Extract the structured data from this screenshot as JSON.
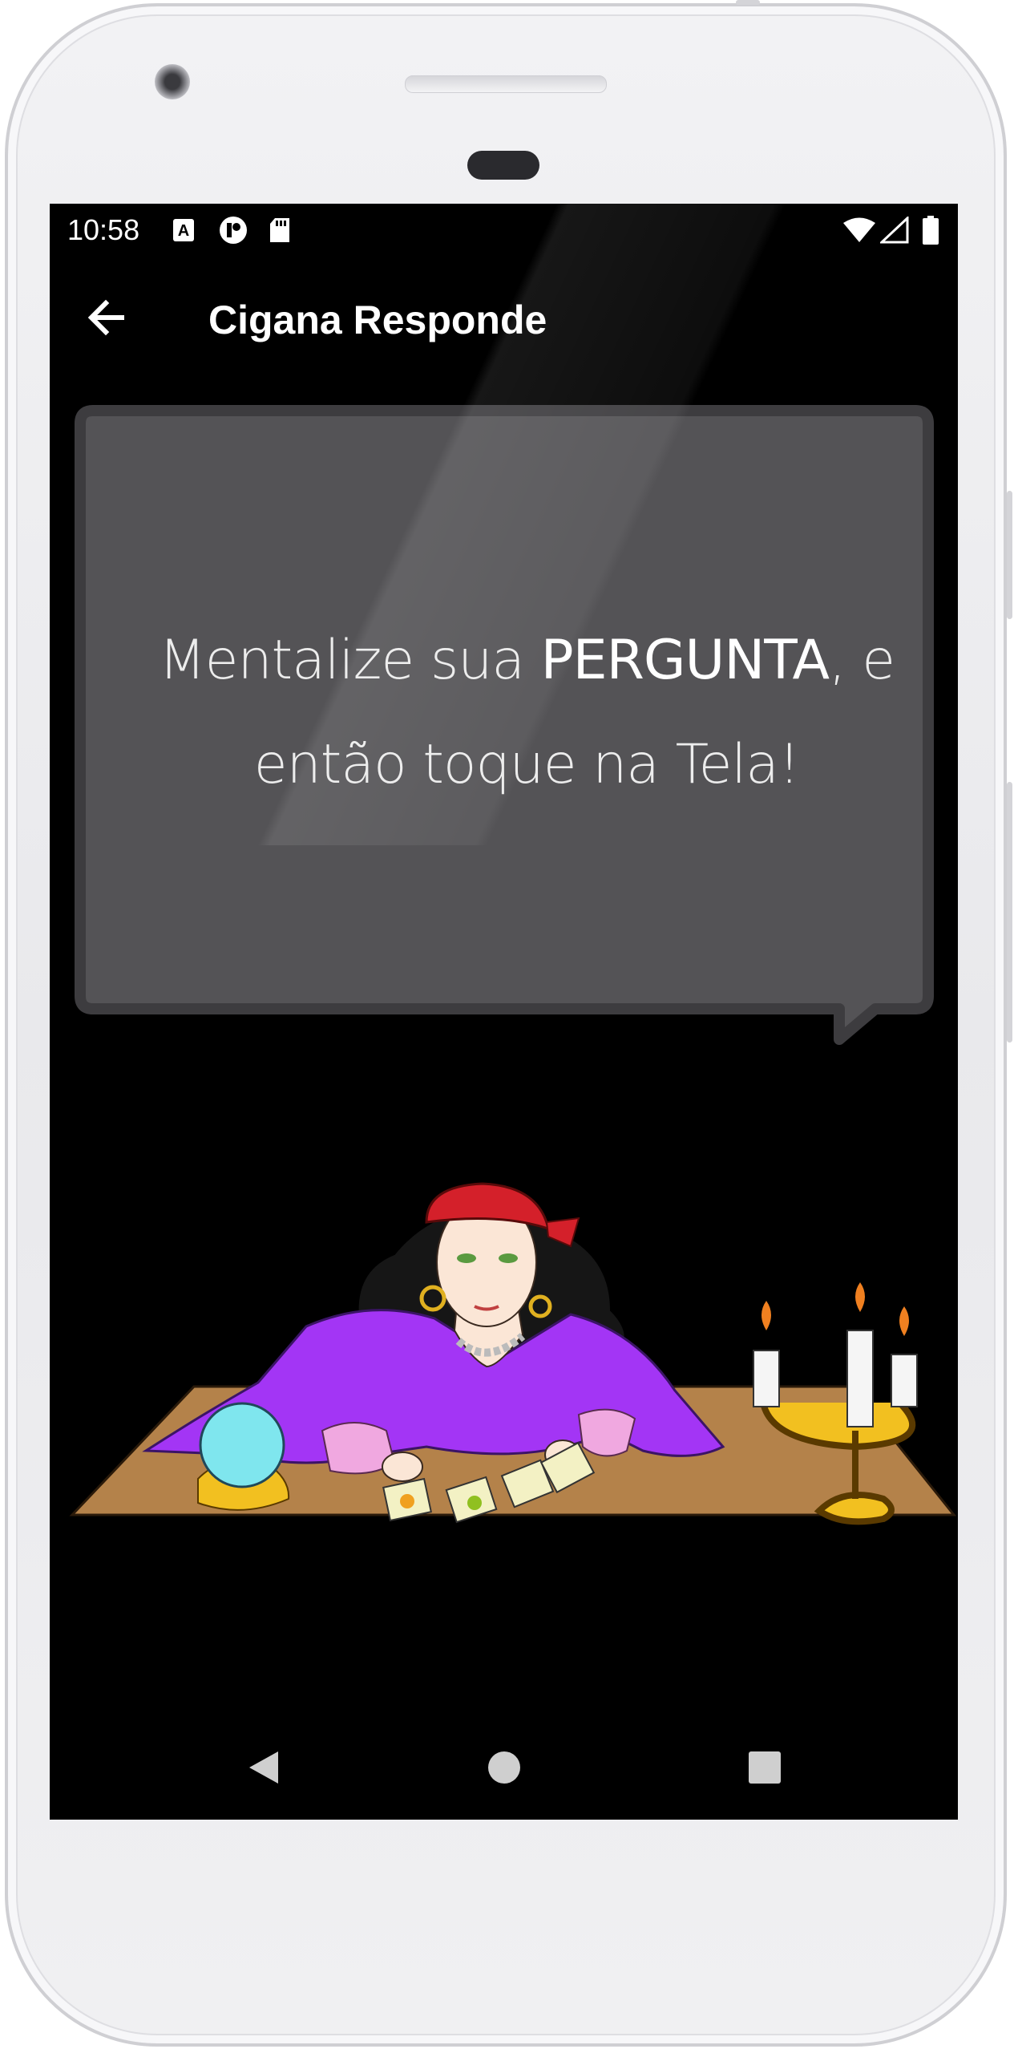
{
  "status_bar": {
    "time": "10:58",
    "icons": [
      "accessibility-a-icon",
      "app-notification-icon",
      "sd-card-icon",
      "wifi-icon",
      "cellular-signal-icon",
      "battery-icon"
    ]
  },
  "app_bar": {
    "title": "Cigana Responde",
    "back_icon": "arrow-back-icon"
  },
  "speech_bubble": {
    "text_before": "Mentalize sua ",
    "text_bold": "PERGUNTA",
    "text_after": ", e então toque na Tela!"
  },
  "illustration": {
    "subject": "gypsy-fortune-teller-with-cards-crystal-ball-candles"
  },
  "nav_bar": {
    "buttons": [
      "back-triangle-icon",
      "home-circle-icon",
      "recents-square-icon"
    ]
  },
  "colors": {
    "screen_background": "#000000",
    "bubble_fill": "#545356",
    "bubble_border": "#3d3c3f",
    "table": "#b4824a",
    "dress": "#a335f5",
    "headscarf": "#d4202a",
    "crystal_ball": "#7fe6ee"
  }
}
